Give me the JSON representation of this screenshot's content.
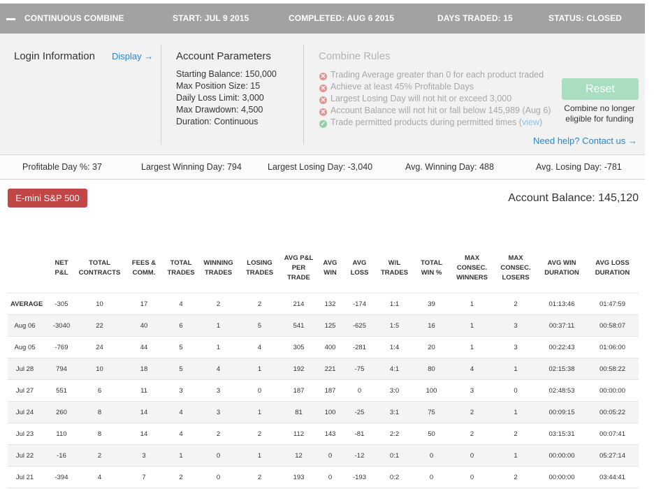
{
  "header": {
    "title": "CONTINUOUS COMBINE",
    "start": "START: JUL 9 2015",
    "completed": "COMPLETED: AUG 6 2015",
    "days_traded": "DAYS TRADED: 15",
    "status": "STATUS: CLOSED"
  },
  "login": {
    "title": "Login Information",
    "display_link": "Display →"
  },
  "account_params": {
    "title": "Account Parameters",
    "items": [
      "Starting Balance: 150,000",
      "Max Position Size: 15",
      "Daily Loss Limit: 3,000",
      "Max Drawdown: 4,500",
      "Duration: Continuous"
    ]
  },
  "combine_rules": {
    "title": "Combine Rules",
    "rules": [
      {
        "text": "Trading Average greater than 0 for each product traded",
        "status": "fail"
      },
      {
        "text": "Achieve at least 45% Profitable Days",
        "status": "fail"
      },
      {
        "text": "Largest Losing Day will not hit or exceed 3,000",
        "status": "fail"
      },
      {
        "text": "Account Balance will not hit or fall below 145,989 (Aug 6)",
        "status": "fail"
      },
      {
        "text": "Trade permitted products during permitted times (",
        "link": "view",
        "suffix": ")",
        "status": "pass"
      }
    ],
    "reset_label": "Reset",
    "note": "Combine no longer eligible for funding",
    "help_link": "Need help? Contact us →"
  },
  "stats": {
    "profitable_day": "Profitable Day %: 37",
    "largest_winning": "Largest Winning Day: 794",
    "largest_losing": "Largest Losing Day: -3,040",
    "avg_winning": "Avg. Winning Day: 488",
    "avg_losing": "Avg. Losing Day: -781"
  },
  "product_tab": "E-mini S&P 500",
  "account_balance": "Account Balance: 145,120",
  "table": {
    "columns": [
      "",
      "NET P&L",
      "TOTAL CONTRACTS",
      "FEES & COMM.",
      "TOTAL TRADES",
      "WINNING TRADES",
      "LOSING TRADES",
      "AVG P&L PER TRADE",
      "AVG WIN",
      "AVG LOSS",
      "W/L TRADES",
      "TOTAL WIN %",
      "MAX CONSEC. WINNERS",
      "MAX CONSEC. LOSERS",
      "AVG WIN DURATION",
      "AVG LOSS DURATION"
    ],
    "average": [
      "AVERAGE",
      "-305",
      "10",
      "17",
      "4",
      "2",
      "2",
      "214",
      "132",
      "-174",
      "1:1",
      "39",
      "1",
      "2",
      "01:13:46",
      "01:47:59"
    ],
    "rows": [
      [
        "Aug 06",
        "-3040",
        "22",
        "40",
        "6",
        "1",
        "5",
        "541",
        "125",
        "-625",
        "1:5",
        "16",
        "1",
        "3",
        "00:37:11",
        "00:58:07"
      ],
      [
        "Aug 05",
        "-769",
        "24",
        "44",
        "5",
        "1",
        "4",
        "305",
        "400",
        "-281",
        "1:4",
        "20",
        "1",
        "3",
        "00:22:43",
        "01:06:00"
      ],
      [
        "Jul 28",
        "794",
        "10",
        "18",
        "5",
        "4",
        "1",
        "192",
        "221",
        "-75",
        "4:1",
        "80",
        "4",
        "1",
        "02:15:38",
        "00:58:22"
      ],
      [
        "Jul 27",
        "551",
        "6",
        "11",
        "3",
        "3",
        "0",
        "187",
        "187",
        "0",
        "3:0",
        "100",
        "3",
        "0",
        "02:48:53",
        "00:00:00"
      ],
      [
        "Jul 24",
        "260",
        "8",
        "14",
        "4",
        "3",
        "1",
        "81",
        "100",
        "-25",
        "3:1",
        "75",
        "2",
        "1",
        "00:09:15",
        "00:05:22"
      ],
      [
        "Jul 23",
        "110",
        "8",
        "14",
        "4",
        "2",
        "2",
        "112",
        "143",
        "-81",
        "2:2",
        "50",
        "2",
        "2",
        "03:15:31",
        "00:07:41"
      ],
      [
        "Jul 22",
        "-16",
        "2",
        "3",
        "1",
        "0",
        "1",
        "12",
        "0",
        "-12",
        "0:1",
        "0",
        "0",
        "1",
        "00:00:00",
        "05:27:14"
      ],
      [
        "Jul 21",
        "-394",
        "4",
        "7",
        "2",
        "0",
        "2",
        "193",
        "0",
        "-193",
        "0:2",
        "0",
        "0",
        "2",
        "00:00:00",
        "03:44:41"
      ]
    ]
  }
}
